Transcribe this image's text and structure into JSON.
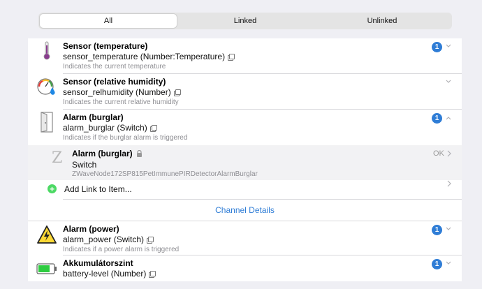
{
  "filter_tabs": [
    "All",
    "Linked",
    "Unlinked"
  ],
  "channels": [
    {
      "title": "Sensor (temperature)",
      "subtitle": "sensor_temperature (Number:Temperature)",
      "description": "Indicates the current temperature",
      "badge": "1",
      "icon": "thermometer-icon"
    },
    {
      "title": "Sensor (relative humidity)",
      "subtitle": "sensor_relhumidity (Number)",
      "description": "Indicates the current relative humidity",
      "icon": "humidity-gauge-icon"
    },
    {
      "title": "Alarm (burglar)",
      "subtitle": "alarm_burglar (Switch)",
      "description": "Indicates if the burglar alarm is triggered",
      "badge": "1",
      "icon": "door-icon"
    },
    {
      "title": "Alarm (power)",
      "subtitle": "alarm_power (Switch)",
      "description": "Indicates if a power alarm is triggered",
      "badge": "1",
      "icon": "power-warning-icon"
    },
    {
      "title": "Akkumulátorszint",
      "subtitle": "battery-level (Number)",
      "badge": "1",
      "icon": "battery-icon"
    }
  ],
  "linked_item": {
    "title": "Alarm (burglar)",
    "type": "Switch",
    "name": "ZWaveNode172SP815PetImmunePIRDetectorAlarmBurglar",
    "status": "OK",
    "icon_letter": "Z"
  },
  "add_link_label": "Add Link to Item...",
  "channel_details_label": "Channel Details",
  "colors": {
    "accent": "#2f7dd6",
    "add": "#4cd964"
  }
}
